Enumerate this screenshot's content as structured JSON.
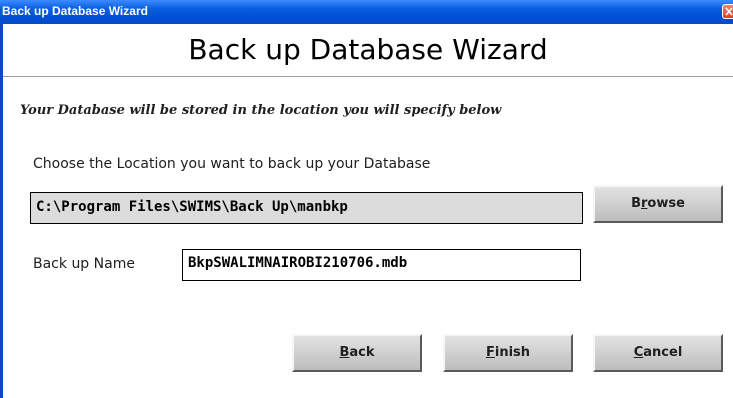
{
  "window": {
    "title": "Back up Database Wizard",
    "close_icon": "close-icon"
  },
  "header": {
    "title": "Back up Database Wizard"
  },
  "instructions": "Your Database will be stored in the location you will specify below",
  "location": {
    "label": "Choose the Location you want to back up your Database",
    "value": "C:\\Program Files\\SWIMS\\Back Up\\manbkp"
  },
  "buttons": {
    "browse": {
      "before": "B",
      "accel": "r",
      "after": "owse"
    },
    "back": {
      "before": "",
      "accel": "B",
      "after": "ack"
    },
    "finish": {
      "before": "",
      "accel": "F",
      "after": "inish"
    },
    "cancel": {
      "before": "",
      "accel": "C",
      "after": "ancel"
    }
  },
  "backup_name": {
    "label": "Back up Name",
    "value": "BkpSWALIMNAIROBI210706.mdb"
  },
  "colors": {
    "titlebar": "#0a5fe0",
    "close_button": "#d5451e",
    "disabled_field": "#dcdcdc",
    "button_face": "#d0d0d0"
  }
}
